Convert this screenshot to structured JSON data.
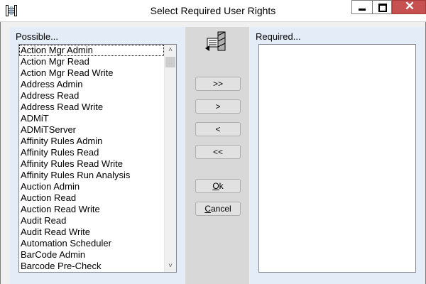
{
  "window": {
    "title": "Select Required User Rights",
    "close_glyph": "✕"
  },
  "icons": {
    "app": "app-transfer-icon",
    "center": "transfer-list-icon"
  },
  "possible": {
    "label": "Possible...",
    "items": [
      "Action Mgr Admin",
      "Action Mgr Read",
      "Action Mgr Read Write",
      "Address Admin",
      "Address Read",
      "Address Read Write",
      "ADMiT",
      "ADMiTServer",
      "Affinity Rules Admin",
      "Affinity Rules Read",
      "Affinity Rules Read Write",
      "Affinity Rules Run Analysis",
      "Auction Admin",
      "Auction Read",
      "Auction Read Write",
      "Audit Read",
      "Audit Read Write",
      "Automation Scheduler",
      "BarCode Admin",
      "Barcode Pre-Check"
    ]
  },
  "required": {
    "label": "Required...",
    "items": []
  },
  "buttons": {
    "add_all": ">>",
    "add": ">",
    "remove": "<",
    "remove_all": "<<",
    "ok_mnemonic": "O",
    "ok_rest": "k",
    "cancel_mnemonic": "C",
    "cancel_rest": "ancel"
  },
  "colors": {
    "panel": "#e4ecf7",
    "center_panel": "#d8d8d8",
    "close_button": "#c75050"
  }
}
